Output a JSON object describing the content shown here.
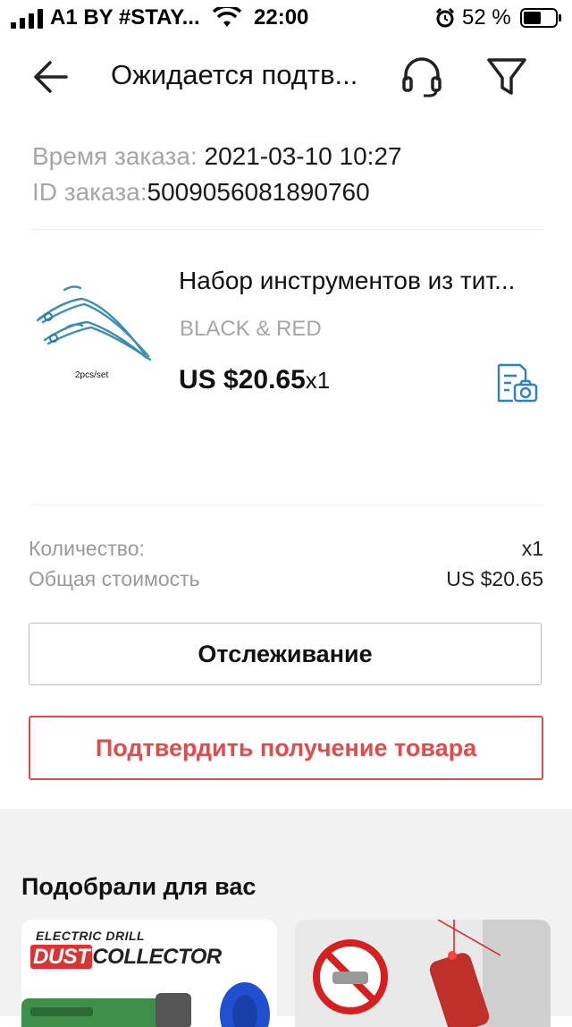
{
  "status_bar": {
    "carrier": "A1 BY #STAY...",
    "time": "22:00",
    "battery_percent": "52 %",
    "icons": [
      "signal-icon",
      "wifi-icon",
      "alarm-icon",
      "battery-icon"
    ]
  },
  "header": {
    "title": "Ожидается подтв...",
    "icons": [
      "back-arrow-icon",
      "headset-icon",
      "filter-icon"
    ]
  },
  "order": {
    "time_label": "Время заказа:",
    "time_value": "2021-03-10 10:27",
    "id_label": "ID заказа:",
    "id_value": "5009056081890760"
  },
  "product": {
    "title": "Набор инструментов из тит...",
    "variant": "BLACK & RED",
    "price": "US $20.65",
    "quantity": "x1",
    "image_caption": "2pcs/set",
    "photo_icon": "document-camera-icon"
  },
  "summary": {
    "quantity_label": "Количество:",
    "quantity_value": "x1",
    "total_label": "Общая стоимость",
    "total_value": "US $20.65"
  },
  "actions": {
    "track_label": "Отслеживание",
    "confirm_label": "Подтвердить получение товара"
  },
  "recommendations": {
    "title": "Подобрали для вас",
    "card1": {
      "top_text": "ELECTRIC DRILL",
      "brand_a": "DUST",
      "brand_b": "COLLECTOR"
    }
  },
  "colors": {
    "accent_red": "#e24b4b",
    "icon_blue": "#2b82c9",
    "muted_text": "#a6a6a6"
  }
}
